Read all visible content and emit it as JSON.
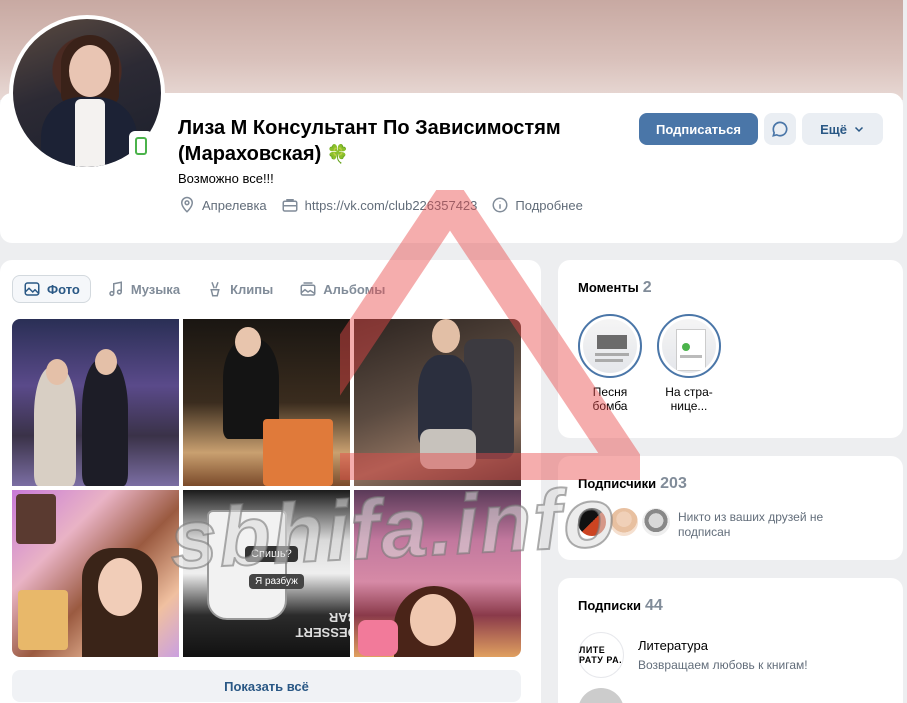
{
  "profile": {
    "name": "Лиза М Консультант По Зависимостям (Мараховская)",
    "name_emoji": "🍀",
    "status": "Возможно все!!!",
    "location": "Апрелевка",
    "link": "https://vk.com/club226357423",
    "details_label": "Подробнее"
  },
  "actions": {
    "subscribe": "Подписаться",
    "more": "Ещё"
  },
  "tabs": [
    {
      "label": "Фото",
      "icon": "photo-icon",
      "active": true
    },
    {
      "label": "Музыка",
      "icon": "music-icon",
      "active": false
    },
    {
      "label": "Клипы",
      "icon": "clips-icon",
      "active": false
    },
    {
      "label": "Альбомы",
      "icon": "albums-icon",
      "active": false
    }
  ],
  "photos": {
    "p5_cup_text1": "Спишь?",
    "p5_cup_text2": "Я разбуж",
    "p5_bar_text": "DESSERT BAR",
    "show_all": "Показать всё"
  },
  "moments": {
    "title": "Моменты",
    "count": "2",
    "items": [
      {
        "label": "Песня бомба"
      },
      {
        "label": "На стра-ни­це..."
      }
    ]
  },
  "subscribers": {
    "title": "Подписчики",
    "count": "203",
    "note": "Никто из ваших друзей не подписан"
  },
  "follows": {
    "title": "Подписки",
    "count": "44",
    "items": [
      {
        "logo": "ЛИТЕ РАТУ РА.",
        "name": "Литература",
        "desc": "Возвращаем любовь к книгам!"
      }
    ]
  },
  "watermark": "sbhifa.info",
  "colors": {
    "accent": "#4a76a8",
    "link": "#2a5885",
    "online": "#4bb34b",
    "watermark_triangle": "#e84a4a"
  }
}
